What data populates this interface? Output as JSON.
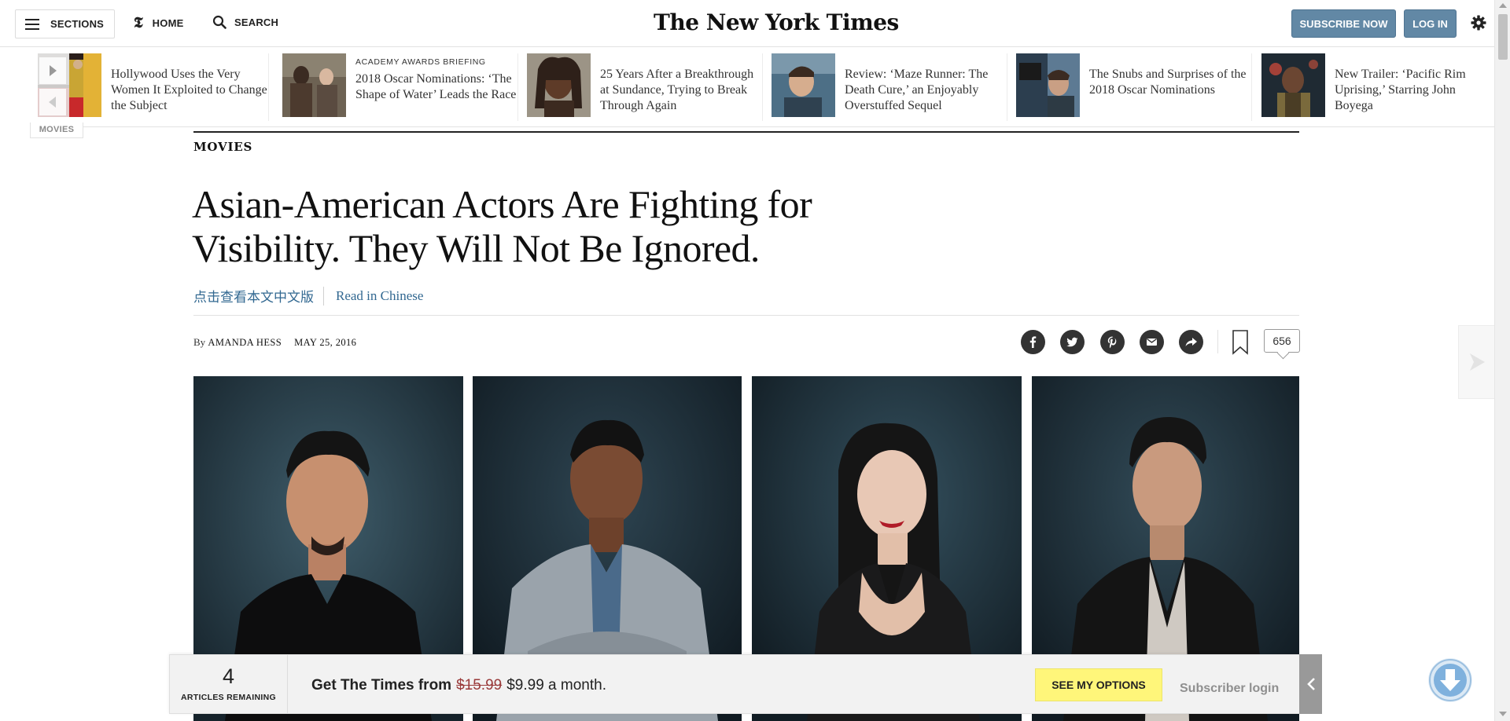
{
  "masthead": {
    "sections_label": "SECTIONS",
    "home_label": "HOME",
    "search_label": "SEARCH",
    "logo_text": "The New York Times",
    "subscribe_label": "SUBSCRIBE NOW",
    "login_label": "LOG IN"
  },
  "ribbon": {
    "section_tab": "MOVIES",
    "items": [
      {
        "kicker": "",
        "title": "Hollywood Uses the Very Women It Exploited to Change the Subject"
      },
      {
        "kicker": "ACADEMY AWARDS BRIEFING",
        "title": "2018 Oscar Nominations: ‘The Shape of Water’ Leads the Race"
      },
      {
        "kicker": "",
        "title": "25 Years After a Breakthrough at Sundance, Trying to Break Through Again"
      },
      {
        "kicker": "",
        "title": "Review: ‘Maze Runner: The Death Cure,’ an Enjoyably Overstuffed Sequel"
      },
      {
        "kicker": "",
        "title": "The Snubs and Surprises of the 2018 Oscar Nominations"
      },
      {
        "kicker": "",
        "title": "New Trailer: ‘Pacific Rim Uprising,’ Starring John Boyega"
      }
    ]
  },
  "article": {
    "kicker": "MOVIES",
    "headline": "Asian-American Actors Are Fighting for Visibility. They Will Not Be Ignored.",
    "chinese_link": "点击查看本文中文版",
    "english_link": "Read in Chinese",
    "byline_prefix": "By",
    "author": "AMANDA HESS",
    "date": "MAY 25, 2016",
    "comment_count": "656"
  },
  "share_icons": [
    "facebook-icon",
    "twitter-icon",
    "pinterest-icon",
    "email-icon",
    "share-icon"
  ],
  "paywall": {
    "count": "4",
    "count_label": "ARTICLES REMAINING",
    "offer_lead": "Get The Times from",
    "old_price": "$15.99",
    "new_price": "$9.99 a month.",
    "button_label": "SEE MY OPTIONS",
    "login_label": "Subscriber login"
  },
  "colors": {
    "accent_blue": "#6288a5",
    "link_blue": "#326891",
    "paywall_button": "#fff67a"
  }
}
